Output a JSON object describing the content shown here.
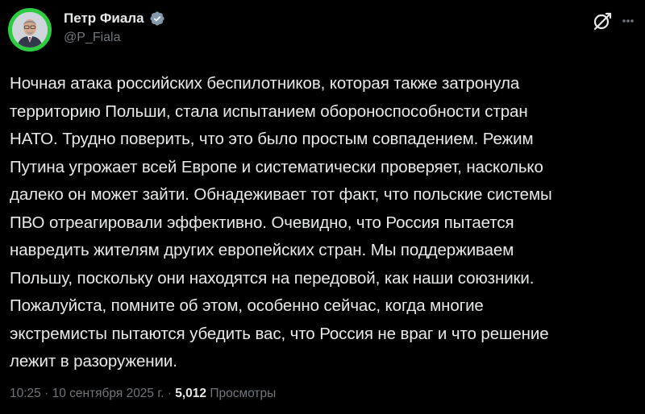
{
  "author": {
    "name": "Петр Фиала",
    "handle": "@P_Fiala",
    "verified": true,
    "avatar_ring_color": "#2ecc40"
  },
  "post": {
    "lines": [
      "Ночная атака российских беспилотников, которая также затронула",
      "территорию Польши, стала испытанием обороноспособности стран",
      "НАТО. Трудно поверить, что это было простым совпадением. Режим",
      "Путина угрожает всей Европе и систематически проверяет, насколько",
      "далеко он может зайти. Обнадеживает тот факт, что польские системы",
      "ПВО отреагировали эффективно. Очевидно, что Россия пытается",
      "навредить жителям других европейских стран. Мы поддерживаем",
      "Польшу, поскольку они находятся на передовой, как наши союзники.",
      "Пожалуйста, помните об этом, особенно сейчас, когда многие",
      "экстремисты пытаются убедить вас, что Россия не враг и что решение",
      "лежит в разоружении."
    ]
  },
  "meta": {
    "time": "10:25",
    "date": "10 сентября 2025 г.",
    "separator": " · ",
    "views_count": "5,012",
    "views_label": "Просмотры"
  },
  "icons": {
    "grok": "grok-icon",
    "more": "more-icon",
    "verified": "verified-badge-icon"
  }
}
